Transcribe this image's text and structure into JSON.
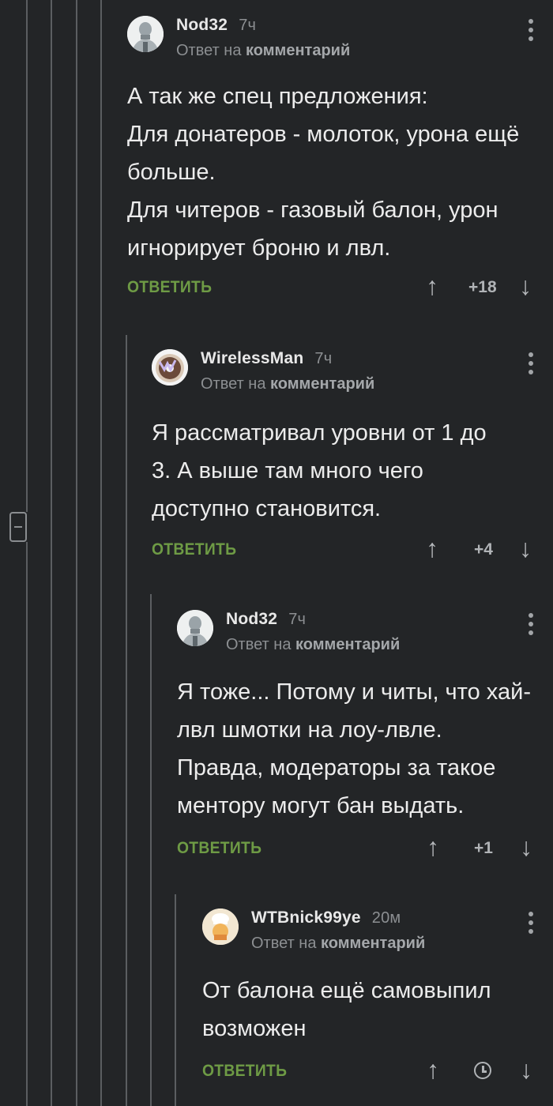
{
  "comments": [
    {
      "author": "Nod32",
      "time": "7ч",
      "reply_prefix": "Ответ на",
      "reply_target": "комментарий",
      "text": "А так же спец предложения:\nДля донатеров - молоток, урона ещё больше.\nДля читеров - газовый балон, урон игнорирует броню и лвл.",
      "reply_label": "ОТВЕТИТЬ",
      "score": "+18",
      "avatar_icon": "robot-avatar-icon"
    },
    {
      "author": "WirelessMan",
      "time": "7ч",
      "reply_prefix": "Ответ на",
      "reply_target": "комментарий",
      "text": "Я рассматривал уровни от 1 до 3. А выше там много чего доступно становится.",
      "reply_label": "ОТВЕТИТЬ",
      "score": "+4",
      "avatar_icon": "donut-avatar-icon"
    },
    {
      "author": "Nod32",
      "time": "7ч",
      "reply_prefix": "Ответ на",
      "reply_target": "комментарий",
      "text": "Я тоже... Потому и читы, что хай-лвл шмотки на лоу-лвле. Правда, модераторы за такое ментору могут бан выдать.",
      "reply_label": "ОТВЕТИТЬ",
      "score": "+1",
      "avatar_icon": "robot-avatar-icon"
    },
    {
      "author": "WTBnick99ye",
      "time": "20м",
      "reply_prefix": "Ответ на",
      "reply_target": "комментарий",
      "text": "От балона ещё самовыпил возможен",
      "reply_label": "ОТВЕТИТЬ",
      "score": "",
      "avatar_icon": "cook-avatar-icon"
    }
  ],
  "colors": {
    "background": "#232527",
    "reply_green": "#6e9b45",
    "muted": "#8c8f92"
  }
}
